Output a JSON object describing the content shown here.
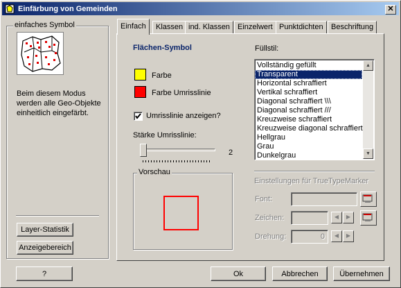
{
  "window": {
    "title": "Einfärbung von Gemeinden",
    "close_glyph": "✕"
  },
  "left": {
    "group_label": "einfaches Symbol",
    "description": "Beim diesem Modus werden alle Geo-Objekte einheitlich eingefärbt.",
    "layer_stat_button": "Layer-Statistik",
    "display_area_button": "Anzeigebereich",
    "help_button": "?"
  },
  "tabs": [
    {
      "label": "Einfach",
      "active": true
    },
    {
      "label": "Klassen"
    },
    {
      "label": "ind. Klassen"
    },
    {
      "label": "Einzelwert"
    },
    {
      "label": "Punktdichten"
    },
    {
      "label": "Beschriftung"
    }
  ],
  "panel": {
    "section_title": "Flächen-Symbol",
    "color_label": "Farbe",
    "color_value": "#ffff00",
    "outline_color_label": "Farbe Umrisslinie",
    "outline_color_value": "#ff0000",
    "show_outline_label": "Umrisslinie anzeigen?",
    "show_outline_checked": true,
    "thickness_label": "Stärke Umrisslinie:",
    "thickness_value": "2",
    "preview_label": "Vorschau",
    "fill_style_label": "Füllstil:",
    "fill_styles": [
      "Vollständig gefüllt",
      "Transparent",
      "Horizontal schraffiert",
      "Vertikal schraffiert",
      "Diagonal schraffiert \\\\\\",
      "Diagonal schraffiert ///",
      "Kreuzweise schraffiert",
      "Kreuzweise diagonal schraffiert",
      "Hellgrau",
      "Grau",
      "Dunkelgrau"
    ],
    "selected_fill_index": 1,
    "truetype_label": "Einstellungen für TrueTypeMarker",
    "font_label": "Font:",
    "char_label": "Zeichen:",
    "rotation_label": "Drehung:",
    "rotation_value": "0"
  },
  "footer": {
    "ok": "Ok",
    "cancel": "Abbrechen",
    "apply": "Übernehmen"
  }
}
